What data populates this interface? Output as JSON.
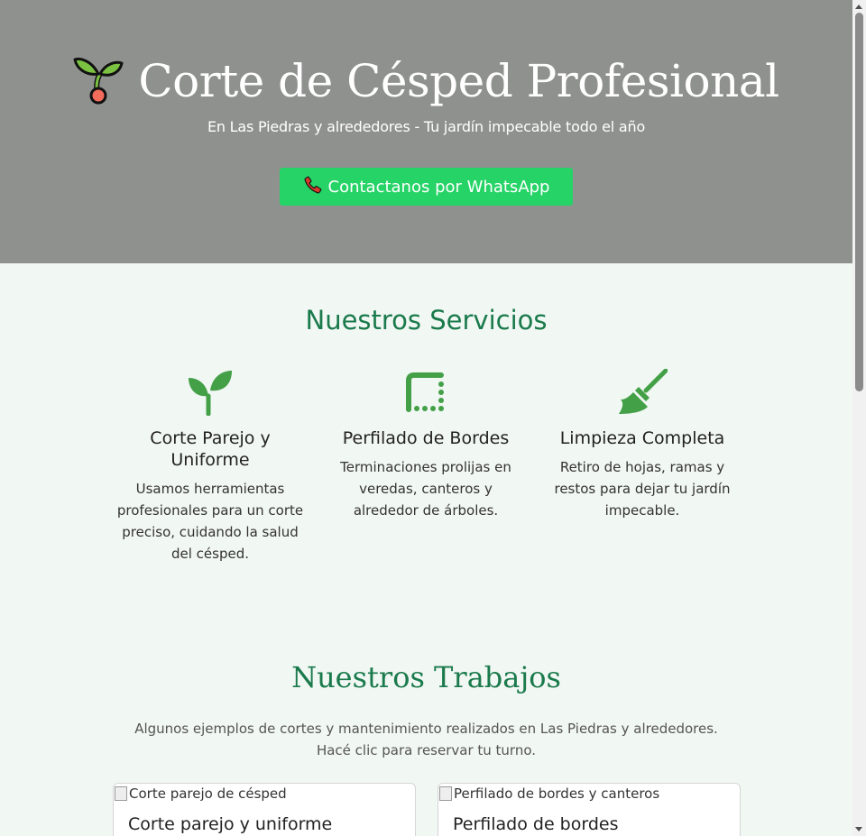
{
  "hero": {
    "title": "Corte de Césped Profesional",
    "subtitle": "En Las Piedras y alrededores - Tu jardín impecable todo el año",
    "cta_label": "Contactanos por WhatsApp",
    "bg_color": "#8f918e",
    "cta_color": "#25d366"
  },
  "services": {
    "title": "Nuestros Servicios",
    "items": [
      {
        "icon": "seedling-icon",
        "title": "Corte Parejo y Uniforme",
        "desc": "Usamos herramientas profesionales para un corte preciso, cuidando la salud del césped."
      },
      {
        "icon": "border-style-icon",
        "title": "Perfilado de Bordes",
        "desc": "Terminaciones prolijas en veredas, canteros y alrededor de árboles."
      },
      {
        "icon": "broom-icon",
        "title": "Limpieza Completa",
        "desc": "Retiro de hojas, ramas y restos para dejar tu jardín impecable."
      }
    ],
    "accent_color": "#1a7a4c"
  },
  "works": {
    "title": "Nuestros Trabajos",
    "desc_line1": "Algunos ejemplos de cortes y mantenimiento realizados en Las Piedras y alrededores.",
    "desc_line2": "Hacé clic para reservar tu turno.",
    "cards": [
      {
        "img_alt": "Corte parejo de césped",
        "title": "Corte parejo y uniforme"
      },
      {
        "img_alt": "Perfilado de bordes y canteros",
        "title": "Perfilado de bordes"
      }
    ]
  }
}
